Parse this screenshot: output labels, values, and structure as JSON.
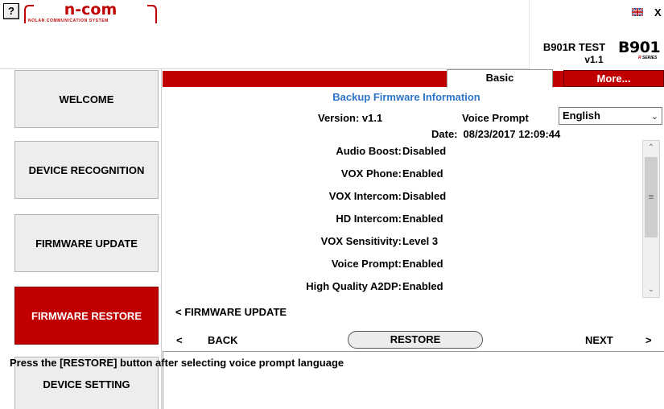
{
  "header": {
    "help_label": "?",
    "logo_word": "n-com",
    "logo_tagline": "NOLAN COMMUNICATION SYSTEM",
    "close_label": "X",
    "device_name": "B901R TEST",
    "device_version": "v1.1",
    "model_logo": "B901",
    "model_series": "SERIES",
    "model_series_letter": "R"
  },
  "sidebar": {
    "items": [
      {
        "label": "WELCOME"
      },
      {
        "label": "DEVICE RECOGNITION"
      },
      {
        "label": "FIRMWARE UPDATE"
      },
      {
        "label": "FIRMWARE RESTORE"
      },
      {
        "label": "DEVICE SETTING"
      }
    ]
  },
  "tabs": {
    "basic": "Basic",
    "more": "More..."
  },
  "backup": {
    "title": "Backup Firmware Information",
    "version": "Version: v1.1",
    "voice_prompt_label": "Voice Prompt",
    "voice_prompt_value": "English",
    "date_label": "Date:",
    "date_value": "08/23/2017 12:09:44",
    "settings": [
      {
        "key": "Audio Boost:",
        "value": "Disabled"
      },
      {
        "key": "VOX Phone:",
        "value": "Enabled"
      },
      {
        "key": "VOX Intercom:",
        "value": "Disabled"
      },
      {
        "key": "HD Intercom:",
        "value": "Enabled"
      },
      {
        "key": "VOX Sensitivity:",
        "value": "Level 3"
      },
      {
        "key": "Voice Prompt:",
        "value": "Enabled"
      },
      {
        "key": "High Quality A2DP:",
        "value": "Enabled"
      }
    ]
  },
  "navigation": {
    "prev_section": "< FIRMWARE UPDATE",
    "lt": "<",
    "back": "BACK",
    "restore": "RESTORE",
    "next": "NEXT",
    "gt": ">"
  },
  "hint": "Press the [RESTORE] button after selecting voice prompt language",
  "colors": {
    "accent": "#c00000",
    "title_blue": "#2e75c9"
  }
}
